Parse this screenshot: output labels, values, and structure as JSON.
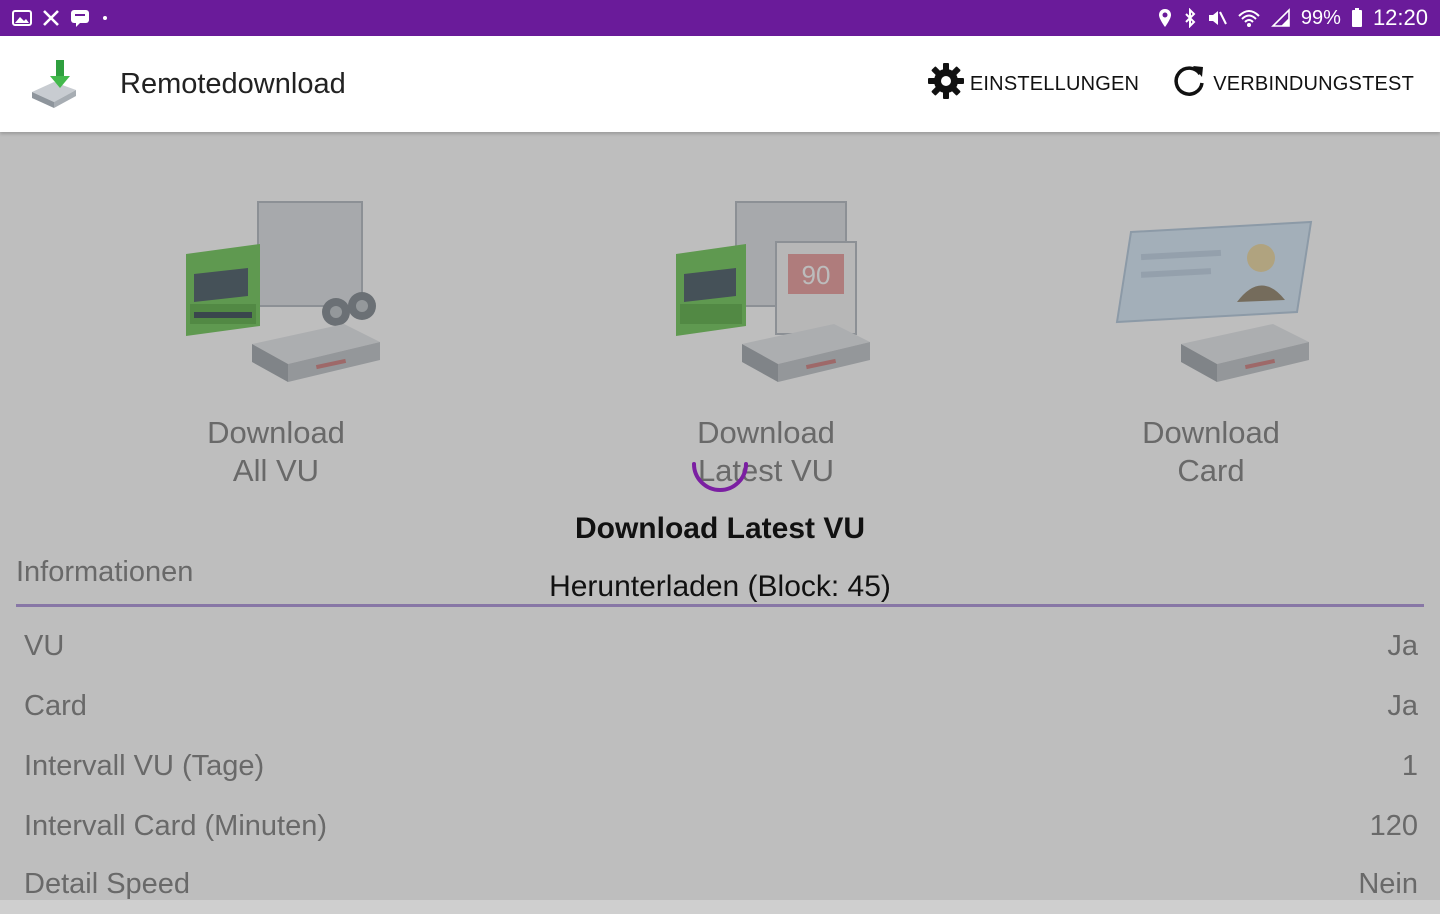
{
  "status_bar": {
    "left_icons": [
      "gallery-icon",
      "x-app-icon",
      "chat-icon",
      "dot-icon"
    ],
    "right_icons": [
      "location-icon",
      "bluetooth-icon",
      "mute-icon",
      "wifi-icon",
      "signal-icon"
    ],
    "battery": "99%",
    "time": "12:20"
  },
  "toolbar": {
    "title": "Remotedownload",
    "settings_label": "EINSTELLUNGEN",
    "connection_test_label": "VERBINDUNGSTEST"
  },
  "tiles": [
    {
      "label_line1": "Download",
      "label_line2": "All VU"
    },
    {
      "label_line1": "Download",
      "label_line2": "Latest VU",
      "badge": "90"
    },
    {
      "label_line1": "Download",
      "label_line2": "Card"
    }
  ],
  "info": {
    "header": "Informationen",
    "rows": [
      {
        "label": "VU",
        "value": "Ja"
      },
      {
        "label": "Card",
        "value": "Ja"
      },
      {
        "label": "Intervall VU (Tage)",
        "value": "1"
      },
      {
        "label": "Intervall Card (Minuten)",
        "value": "120"
      },
      {
        "label": "Detail Speed",
        "value": "Nein"
      }
    ]
  },
  "dialog": {
    "title": "Download Latest VU",
    "message": "Herunterladen (Block: 45)"
  },
  "colors": {
    "status_bar": "#6a1b9a",
    "accent": "#7b1fa2",
    "divider": "#b39ddb"
  }
}
